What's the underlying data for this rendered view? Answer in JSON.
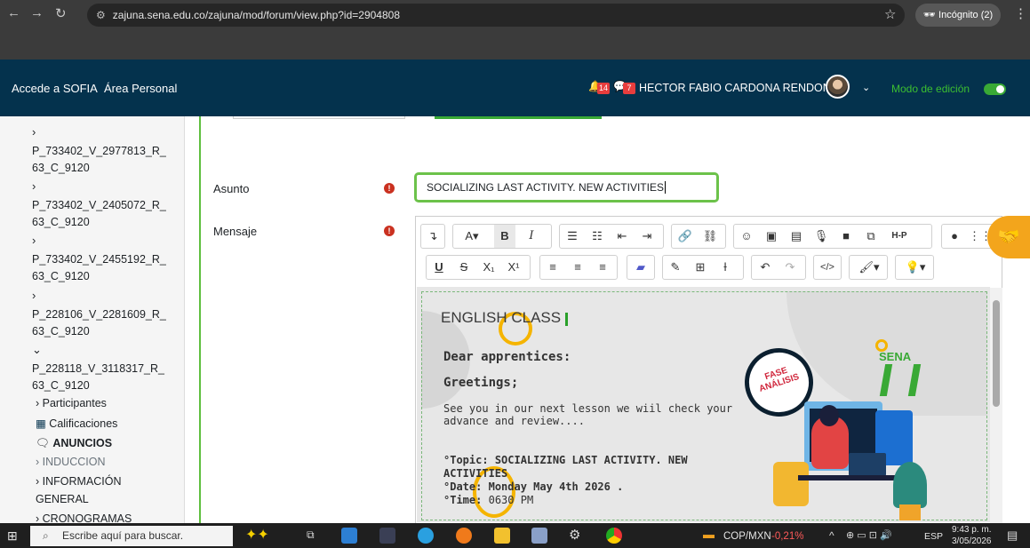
{
  "browser": {
    "url": "zajuna.sena.edu.co/zajuna/mod/forum/view.php?id=2904808",
    "incognito_label": "Incógnito (2)"
  },
  "header": {
    "link_sofia": "Accede a SOFIA",
    "link_area": "Área Personal",
    "notifications_count": "14",
    "messages_count": "7",
    "user_name": "HECTOR FABIO CARDONA RENDON",
    "edit_mode_label": "Modo de edición",
    "edit_mode_on": true,
    "edit_mode_color": "#39a935"
  },
  "sidebar": {
    "items": [
      {
        "code_line1": "P_733402_V_2977813_R_",
        "code_line2": "63_C_9120",
        "expanded": false
      },
      {
        "code_line1": "P_733402_V_2405072_R_",
        "code_line2": "63_C_9120",
        "expanded": false
      },
      {
        "code_line1": "P_733402_V_2455192_R_",
        "code_line2": "63_C_9120",
        "expanded": false
      },
      {
        "code_line1": "P_228106_V_2281609_R_",
        "code_line2": "63_C_9120",
        "expanded": false
      },
      {
        "code_line1": "P_228118_V_3118317_R_",
        "code_line2": "63_C_9120",
        "expanded": true
      }
    ],
    "sub": {
      "participantes": "Participantes",
      "calificaciones": "Calificaciones",
      "anuncios": "ANUNCIOS",
      "induccion": "INDUCCION",
      "info_general_1": "INFORMACIÓN",
      "info_general_2": "GENERAL",
      "cronogramas": "CRONOGRAMAS"
    }
  },
  "form": {
    "subject_label": "Asunto",
    "subject_value": "SOCIALIZING LAST ACTIVITY. NEW ACTIVITIES",
    "message_label": "Mensaje"
  },
  "message": {
    "title": "ENGLISH CLASS",
    "greeting1": "Dear apprentices:",
    "greeting2": "Greetings;",
    "body_line1": "See you in our next lesson we wiil check your",
    "body_line2": "advance and review....",
    "topic_label": "°Topic:",
    "topic_value_1": "SOCIALIZING LAST ACTIVITY. NEW",
    "topic_value_2": "ACTIVITIES",
    "date_label": "°Date:",
    "date_value": "Monday May 4th  2026 .",
    "time_label": "°Time:",
    "time_value": "0630 PM",
    "badge_line1": "FASE",
    "badge_line2": "ANÁLISIS",
    "brand": "SENA"
  },
  "taskbar": {
    "search_placeholder": "Escribe aquí para buscar.",
    "currency_pair": "COP/MXN",
    "currency_change": "-0,21%",
    "language": "ESP",
    "time": "9:43 p. m.",
    "date": "3/05/2026"
  }
}
